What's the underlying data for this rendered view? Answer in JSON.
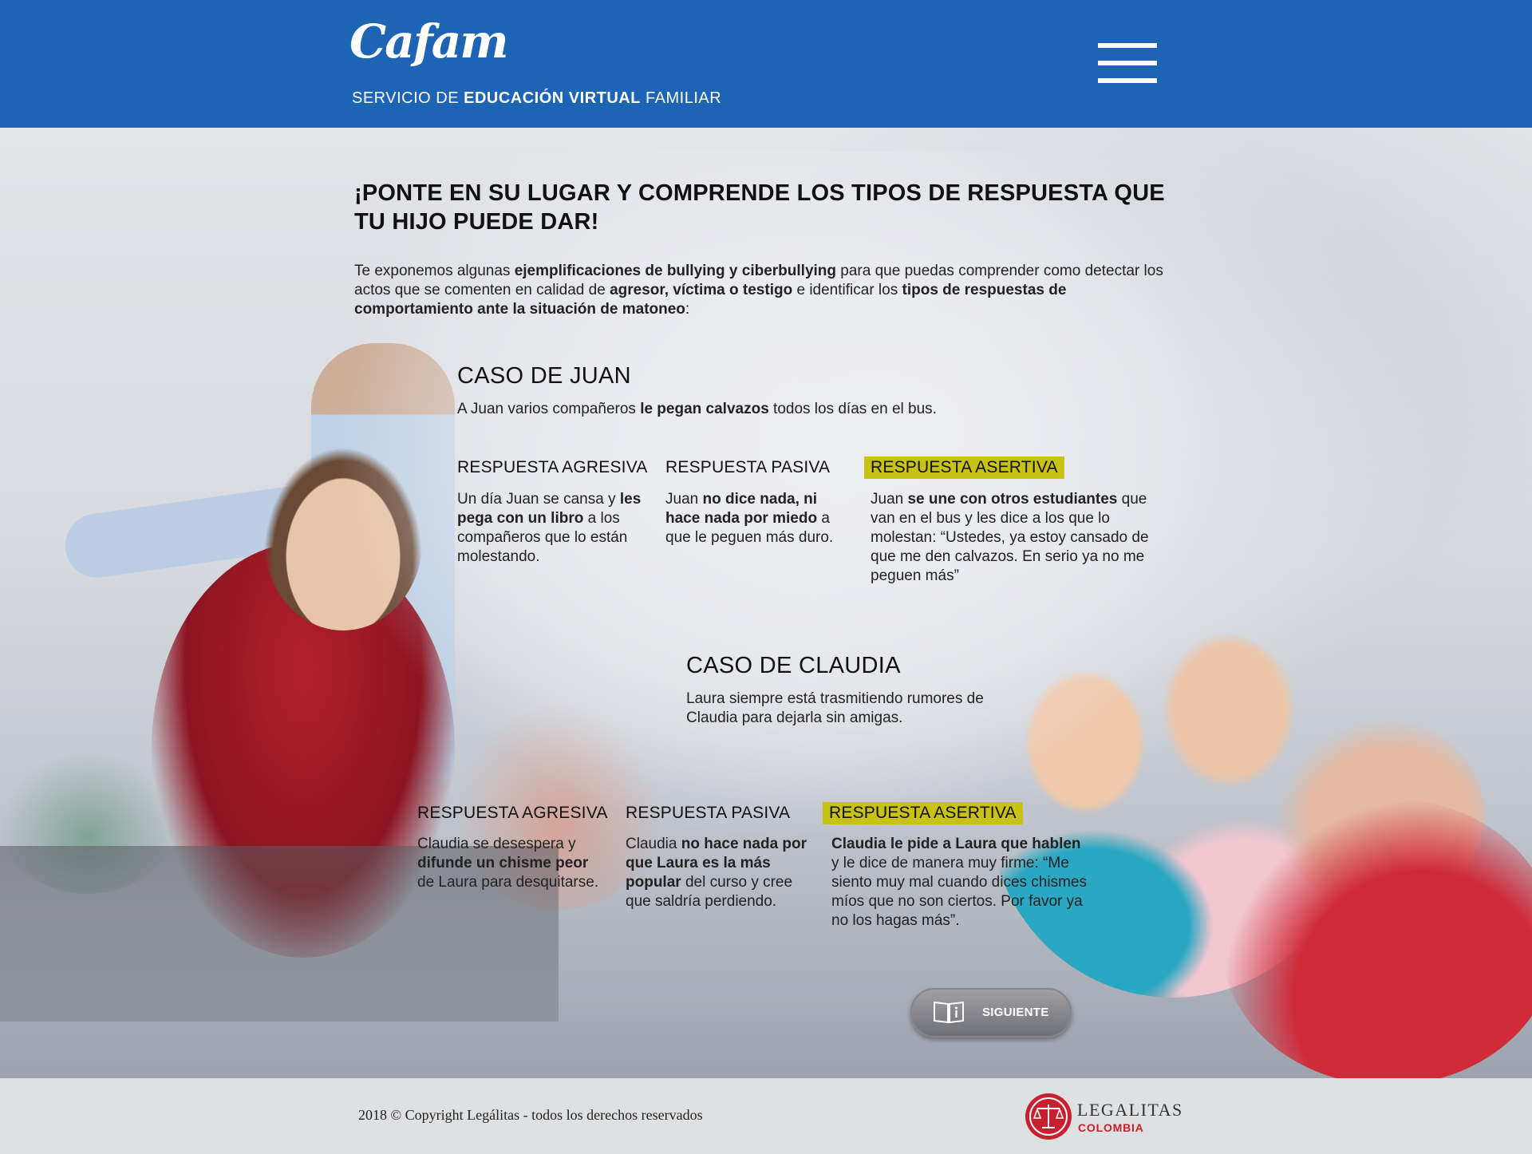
{
  "header": {
    "logo_text": "Cafam",
    "subtitle_pre": "SERVICIO DE ",
    "subtitle_bold": "EDUCACIÓN VIRTUAL",
    "subtitle_post": " FAMILIAR",
    "menu_icon": "hamburger-menu-icon"
  },
  "main": {
    "heading": "¡PONTE EN SU LUGAR Y COMPRENDE LOS TIPOS DE RESPUESTA QUE TU HIJO PUEDE DAR!",
    "intro": {
      "t1": "Te exponemos algunas ",
      "b1": "ejemplificaciones de bullying y ciberbullying",
      "t2": " para que puedas comprender como detectar los actos que se comenten en calidad de ",
      "b2": "agresor, víctima o testigo",
      "t3": " e identificar los ",
      "b3": "tipos de respuestas de comportamiento ante la situación de matoneo",
      "t4": ":"
    }
  },
  "cases": [
    {
      "title": "CASO DE JUAN",
      "desc": {
        "t1": "A Juan varios compañeros ",
        "b1": "le pegan calvazos",
        "t2": " todos los días en el bus."
      },
      "responses": [
        {
          "title": "RESPUESTA AGRESIVA",
          "t1": "Un día Juan se cansa y ",
          "b1": "les pega con un libro",
          "t2": " a los compañeros que lo están molestando."
        },
        {
          "title": "RESPUESTA PASIVA",
          "t1": "Juan ",
          "b1": "no dice nada, ni hace nada por miedo",
          "t2": " a que le peguen más duro."
        },
        {
          "title": "RESPUESTA ASERTIVA",
          "t1": "Juan ",
          "b1": "se une con otros estudiantes",
          "t2": " que van en el bus y les dice a los que lo molestan: “Ustedes, ya estoy cansado de que me den calvazos. En serio ya no me peguen más”"
        }
      ]
    },
    {
      "title": "CASO DE CLAUDIA",
      "desc": {
        "t1": "Laura siempre está trasmitiendo rumores de Claudia para dejarla sin amigas.",
        "b1": "",
        "t2": ""
      },
      "responses": [
        {
          "title": "RESPUESTA AGRESIVA",
          "t1": "Claudia se desespera y ",
          "b1": "difunde un chisme peor",
          "t2": " de Laura para desquitarse."
        },
        {
          "title": "RESPUESTA PASIVA",
          "t1": "Claudia ",
          "b1": "no hace nada por que Laura es la más popular",
          "t2": " del curso y cree que saldría perdiendo."
        },
        {
          "title": "RESPUESTA ASERTIVA",
          "t1": "",
          "b1": "Claudia le pide a Laura que hablen",
          "t2": " y le dice de manera muy firme: “Me siento muy mal cuando dices chismes míos que no son ciertos. Por favor ya no los hagas más”."
        }
      ]
    }
  ],
  "next_button": {
    "label": "SIGUIENTE",
    "icon": "book-info-icon"
  },
  "footer": {
    "copyright": "2018 © Copyright Legálitas - todos los derechos reservados",
    "brand_name": "LEGALITAS",
    "brand_country": "COLOMBIA",
    "brand_icon": "scales-of-justice-icon"
  },
  "colors": {
    "header_blue": "#1d64b4",
    "highlight_yellow": "#c9c216",
    "brand_red": "#c8202f"
  }
}
